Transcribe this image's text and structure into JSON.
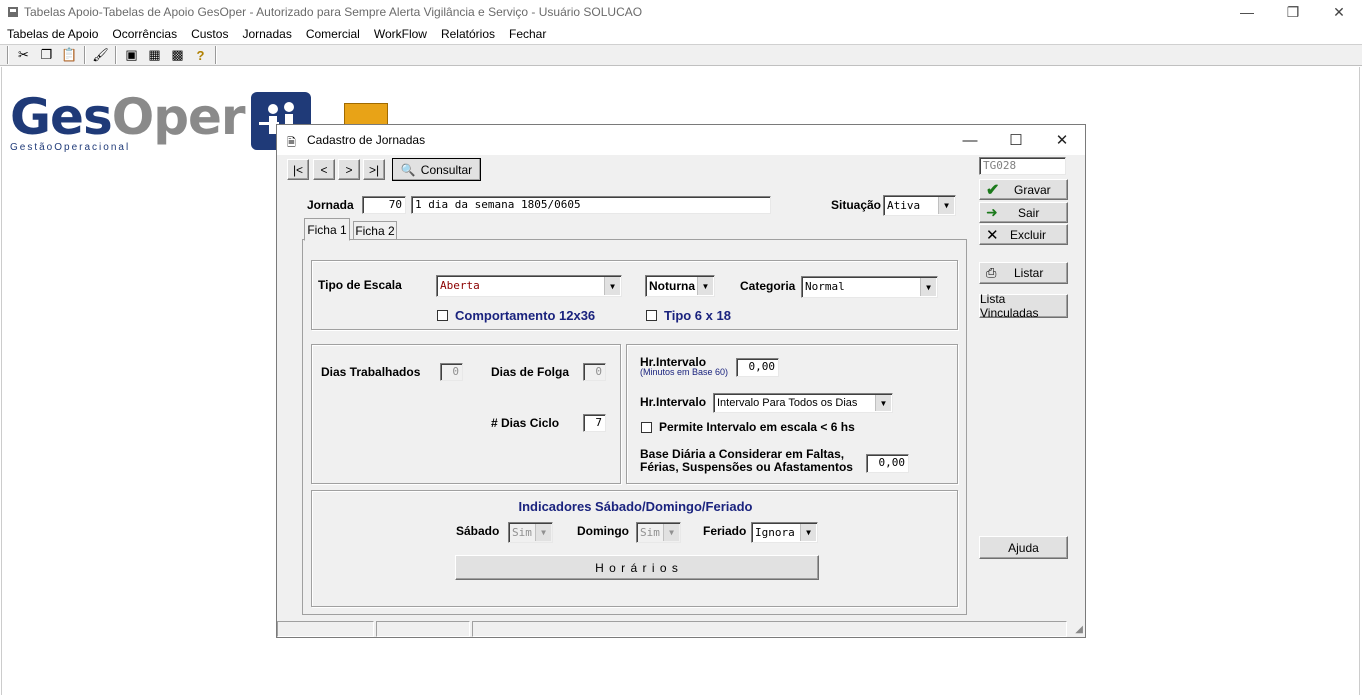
{
  "app": {
    "title": "Tabelas Apoio-Tabelas de Apoio   GesOper - Autorizado para Sempre Alerta Vigilância e Serviço    - Usuário SOLUCAO"
  },
  "menu": [
    "Tabelas de Apoio",
    "Ocorrências",
    "Custos",
    "Jornadas",
    "Comercial",
    "WorkFlow",
    "Relatórios",
    "Fechar"
  ],
  "logo": {
    "ges": "Ges",
    "oper": "Oper",
    "sub": "GestãoOperacional"
  },
  "dialog": {
    "title": "Cadastro de Jornadas",
    "nav": {
      "first": "|<",
      "prev": "<",
      "next": ">",
      "last": ">|",
      "consultar": "Consultar"
    },
    "jornada_label": "Jornada",
    "jornada_code": "70",
    "jornada_desc": "1 dia da semana 1805/0605",
    "situacao_label": "Situação",
    "situacao_value": "Ativa",
    "tabs": [
      "Ficha 1",
      "Ficha 2"
    ],
    "code": "TG028",
    "side_buttons": {
      "gravar": "Gravar",
      "sair": "Sair",
      "excluir": "Excluir",
      "listar": "Listar",
      "lista_vinculadas": "Lista Vinculadas",
      "ajuda": "Ajuda"
    },
    "escala": {
      "tipo_label": "Tipo de Escala",
      "tipo_value": "Aberta",
      "turno_value": "Noturna",
      "categoria_label": "Categoria",
      "categoria_value": "Normal",
      "comportamento_label": "Comportamento 12x36",
      "tipo6x18_label": "Tipo 6 x 18"
    },
    "dias": {
      "trabalhados_label": "Dias Trabalhados",
      "trabalhados_value": "0",
      "folga_label": "Dias de Folga",
      "folga_value": "0",
      "ciclo_label": "# Dias Ciclo",
      "ciclo_value": "7"
    },
    "intervalo": {
      "hr_label": "Hr.Intervalo",
      "hr_sub": "(Minutos em Base 60)",
      "hr_value": "0,00",
      "hr2_label": "Hr.Intervalo",
      "hr2_value": "Intervalo Para Todos os Dias",
      "permite_label": "Permite Intervalo em escala < 6 hs",
      "base_label_1": "Base Diária a Considerar em Faltas,",
      "base_label_2": "Férias, Suspensões ou Afastamentos",
      "base_value": "0,00"
    },
    "indicadores": {
      "title": "Indicadores Sábado/Domingo/Feriado",
      "sabado_label": "Sábado",
      "sabado_value": "Sim",
      "domingo_label": "Domingo",
      "domingo_value": "Sim",
      "feriado_label": "Feriado",
      "feriado_value": "Ignora",
      "horarios_button": "H o r á r i o s"
    }
  },
  "colors": {
    "brand_navy": "#1f3a78",
    "label_navy": "#1a237e",
    "field_red": "#8b0000"
  }
}
